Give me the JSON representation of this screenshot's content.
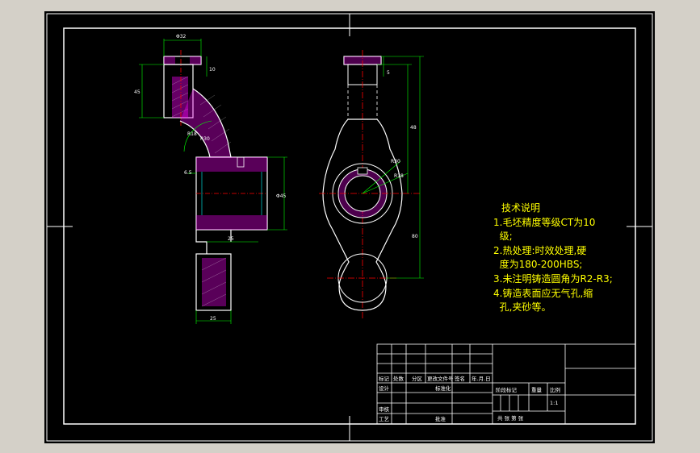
{
  "drawing": {
    "technical_notes": {
      "title": "技术说明",
      "lines": [
        "1.毛坯精度等级CT为10",
        "  级;",
        "2.热处理:时效处理,硬",
        "  度为180-200HBS;",
        "3.未注明铸造圆角为R2-R3;",
        "4.铸造表面应无气孔,缩",
        "  孔,夹砂等。"
      ]
    },
    "title_block": {
      "row_labels": [
        "标记",
        "处数",
        "分区",
        "更改文件号",
        "签名",
        "年.月.日"
      ],
      "design_label": "设计",
      "standardization_label": "标准化",
      "review_label": "审核",
      "process_label": "工艺",
      "approval_label": "批准",
      "stage_mark_label": "阶段标记",
      "weight_label": "重量",
      "scale_label": "比例",
      "scale_value": "1:1",
      "sheets_label": "共  张 第  张"
    },
    "dimensions": {
      "top_width": "Φ32",
      "left_height": "45",
      "boss_width": "10",
      "radius_1": "R18",
      "radius_2": "R30",
      "small_offset": "6.5",
      "bore_dia": "Φ45",
      "lower_offset": "25",
      "foot_width": "25",
      "right_top": "5",
      "overall": "80",
      "center_dist": "48",
      "hole_radius": "R30",
      "hole_dia": "R18"
    }
  }
}
